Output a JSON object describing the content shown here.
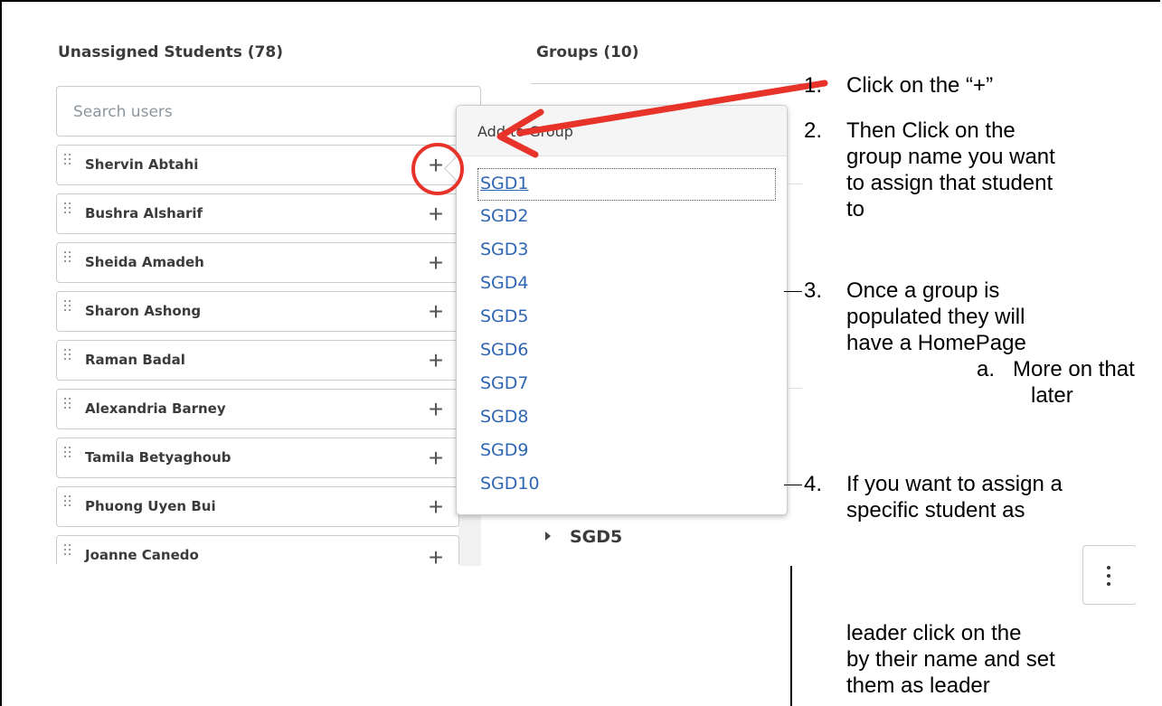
{
  "unassigned": {
    "title": "Unassigned Students (78)",
    "search_placeholder": "Search users",
    "students": [
      {
        "name": "Shervin Abtahi"
      },
      {
        "name": "Bushra Alsharif"
      },
      {
        "name": "Sheida Amadeh"
      },
      {
        "name": "Sharon Ashong"
      },
      {
        "name": "Raman Badal"
      },
      {
        "name": "Alexandria Barney"
      },
      {
        "name": "Tamila Betyaghoub"
      },
      {
        "name": "Phuong Uyen Bui"
      },
      {
        "name": "Joanne Canedo"
      }
    ]
  },
  "groups": {
    "title": "Groups (10)",
    "visible_group": "SGD5"
  },
  "popup": {
    "title": "Add to Group",
    "options": [
      "SGD1",
      "SGD2",
      "SGD3",
      "SGD4",
      "SGD5",
      "SGD6",
      "SGD7",
      "SGD8",
      "SGD9",
      "SGD10"
    ]
  },
  "instructions": {
    "step1_num": "1.",
    "step1": "Click on the “+”",
    "step2_num": "2.",
    "step2_l1": "Then Click on the",
    "step2_l2": "group name you want",
    "step2_l3": "to assign that student",
    "step2_l4": "to",
    "step3_num": "3.",
    "step3_l1": "Once a group is",
    "step3_l2": "populated they will",
    "step3_l3": "have a HomePage",
    "step3a_num": "a.",
    "step3a_l1": "More on that",
    "step3a_l2": "later",
    "step4_num": "4.",
    "step4_l1": "If you want to assign a",
    "step4_l2": "specific student as",
    "step4_l3": "leader click on the",
    "step4_l4": "by their name and set",
    "step4_l5": "them as leader"
  },
  "colors": {
    "annotation_red": "#e8332a",
    "link_blue": "#2f66b3"
  }
}
